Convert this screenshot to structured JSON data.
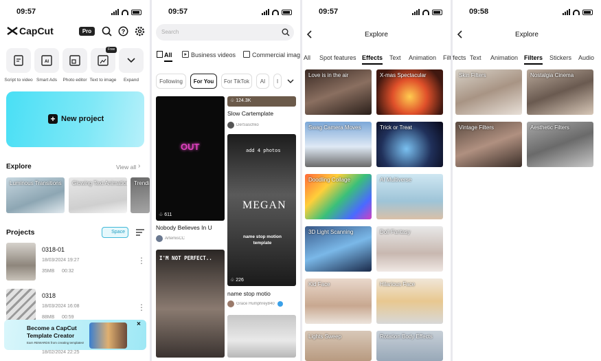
{
  "colors": {
    "accent_cyan": "#3fd8f0",
    "background": "#ffffff"
  },
  "screen1": {
    "time": "09:57",
    "app_name": "CapCut",
    "pro_badge": "Pro",
    "icons": [
      "search-icon",
      "help-icon",
      "settings-icon"
    ],
    "quick_actions": [
      {
        "label": "Script to video",
        "icon": "script-icon"
      },
      {
        "label": "Smart Ads",
        "icon": "ai-ads-icon"
      },
      {
        "label": "Photo editor",
        "icon": "photo-editor-icon"
      },
      {
        "label": "Text to image",
        "icon": "text-image-icon",
        "badge": "Free"
      },
      {
        "label": "Expand",
        "icon": "chevron-down-icon"
      }
    ],
    "new_project_label": "New project",
    "explore_title": "Explore",
    "view_all": "View all",
    "explore_cards": [
      "Luminous Transitions",
      "Glowing Text Animation",
      "Trendin"
    ],
    "projects_title": "Projects",
    "space_label": "Space",
    "projects": [
      {
        "name": "0318-01",
        "date": "18/03/2024 19:27",
        "size": "35MB",
        "duration": "00:32"
      },
      {
        "name": "0318",
        "date": "18/03/2024 16:08",
        "size": "88MB",
        "duration": "00:59"
      },
      {
        "name": "",
        "date": "18/02/2024 22:25",
        "size": "",
        "duration": ""
      }
    ],
    "banner": {
      "title_line1": "Become a CapCut",
      "title_line2": "Template Creator",
      "subtitle": "Earn REWARDS from creating templates!"
    }
  },
  "screen2": {
    "time": "09:57",
    "search_placeholder": "Search",
    "top_tabs": [
      "All",
      "Business videos",
      "Commercial image"
    ],
    "chips": [
      "Following",
      "For You",
      "For TikTok",
      "AI",
      "l"
    ],
    "cards": [
      {
        "title": "Nobody Believes In U",
        "author": "ArtemisCC",
        "count": "611",
        "overlay": "OUT"
      },
      {
        "title": "Slow Cartemplate",
        "author": "DerSaschko",
        "count": "124.3K"
      },
      {
        "title": "name stop motio",
        "author": "Grace Humphrey840",
        "count": "226",
        "overlay_top": "add 4 photos",
        "overlay_mid": "MEGAN",
        "overlay_bot": "name stop motion template"
      },
      {
        "title": "",
        "author": "",
        "count": "",
        "overlay": "I'M NOT PERFECT.."
      }
    ]
  },
  "screen3": {
    "time": "09:57",
    "title": "Explore",
    "tabs": [
      "All",
      "Spot features",
      "Effects",
      "Text",
      "Animation",
      "Filters"
    ],
    "active_tab": "Effects",
    "items": [
      "Love is in the air",
      "X-mas Spectacular",
      "Swag Camera Moves",
      "Trick or Treat",
      "Doodling Collage",
      "AI Multiverse",
      "3D Light Scanning",
      "Doll Fantasy",
      "Kid Face",
      "Hilarious Face",
      "Lights Sweep",
      "Rotation Body Effects"
    ]
  },
  "screen4": {
    "time": "09:58",
    "title": "Explore",
    "tabs": [
      "Effects",
      "Text",
      "Animation",
      "Filters",
      "Stickers",
      "Audio"
    ],
    "active_tab": "Filters",
    "items": [
      "Skin Filters",
      "Nostalgia Cinema",
      "Vintage Filters",
      "Aesthetic Filters"
    ]
  }
}
